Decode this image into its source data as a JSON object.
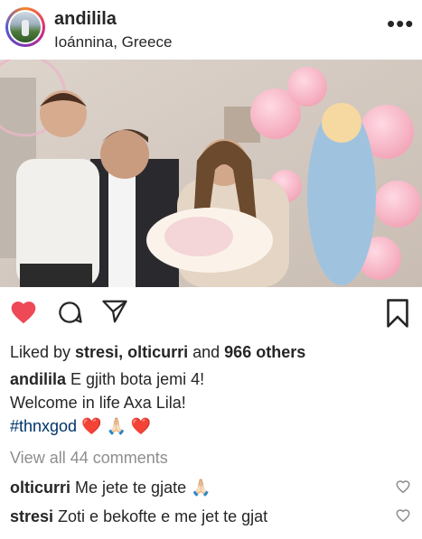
{
  "post": {
    "username": "andililа",
    "location": "Ioánnina, Greece",
    "more_icon": "more-horizontal-icon"
  },
  "actions": {
    "like_icon": "heart-filled-icon",
    "comment_icon": "comment-icon",
    "share_icon": "send-icon",
    "save_icon": "bookmark-icon",
    "like_color": "#ed4956"
  },
  "likes": {
    "prefix": "Liked by ",
    "user1": "stresi",
    "sep": ", ",
    "user2": "olticurri",
    "and": " and ",
    "others": "966 others"
  },
  "caption": {
    "username": "andilila",
    "line1": " E gjith bota jemi 4!",
    "line2": "Welcome in life Axa Lila!",
    "hashtag": "#thnxgod",
    "emoji": " ❤️ 🙏🏻 ❤️"
  },
  "view_comments": "View all 44 comments",
  "comments": [
    {
      "username": "olticurri",
      "text": " Me jete te gjate 🙏🏻"
    },
    {
      "username": "stresi",
      "text": " Zoti e bekofte e me jet te gjat"
    }
  ]
}
